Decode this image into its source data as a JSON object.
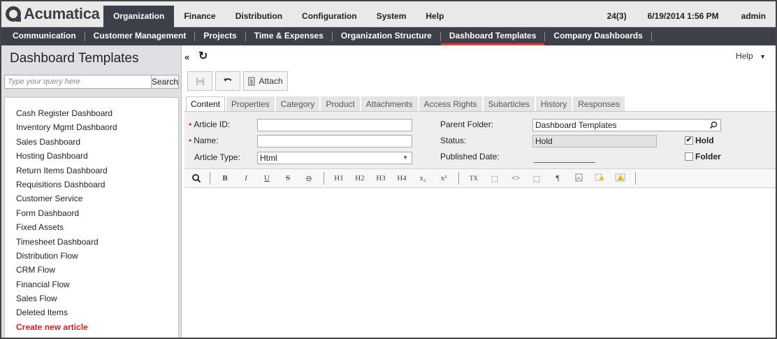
{
  "logo": {
    "text": "Acumatica"
  },
  "topnav": {
    "items": [
      "Organization",
      "Finance",
      "Distribution",
      "Configuration",
      "System",
      "Help"
    ],
    "right": {
      "notifications": "24(3)",
      "datetime": "6/19/2014 1:56 PM",
      "user": "admin"
    }
  },
  "subnav": {
    "items": [
      "Communication",
      "Customer Management",
      "Projects",
      "Time & Expenses",
      "Organization Structure",
      "Dashboard Templates",
      "Company Dashboards"
    ],
    "active": "Dashboard Templates"
  },
  "left": {
    "title": "Dashboard Templates",
    "search_placeholder": "Type your query here",
    "search_button": "Search",
    "items": [
      "Cash Register Dashboard",
      "Inventory Mgmt Dashbaord",
      "Sales Dashboard",
      "Hosting Dashboard",
      "Return Items Dashboard",
      "Requisitions Dashboard",
      "Customer Service",
      "Form Dashbaord",
      "Fixed Assets",
      "Timesheet Dashboard",
      "Distribution Flow",
      "CRM Flow",
      "Financial Flow",
      "Sales Flow",
      "Deleted Items"
    ],
    "create": "Create new article"
  },
  "main": {
    "collapse": "«",
    "refresh": "↻",
    "help": "Help",
    "toolbar": {
      "attach": "Attach"
    },
    "tabs": [
      "Content",
      "Properties",
      "Category",
      "Product",
      "Attachments",
      "Access Rights",
      "Subarticles",
      "History",
      "Responses"
    ],
    "form": {
      "article_id_label": "Article ID:",
      "article_id_value": "",
      "name_label": "Name:",
      "name_value": "",
      "article_type_label": "Article Type:",
      "article_type_value": "Html",
      "parent_folder_label": "Parent Folder:",
      "parent_folder_value": "Dashboard Templates",
      "status_label": "Status:",
      "status_value": "Hold",
      "published_date_label": "Published Date:",
      "hold_label": "Hold",
      "hold_checked": true,
      "folder_label": "Folder",
      "folder_checked": false
    },
    "editor_buttons": [
      "B",
      "I",
      "U",
      "S",
      "H1",
      "H2",
      "H3",
      "H4",
      "x₂",
      "x²",
      "TX",
      "⬚",
      "<>",
      "⬚",
      "¶"
    ]
  },
  "colors": {
    "accent": "#e23c3c",
    "dark_bar": "#3d4049",
    "required": "#d61f1f"
  }
}
